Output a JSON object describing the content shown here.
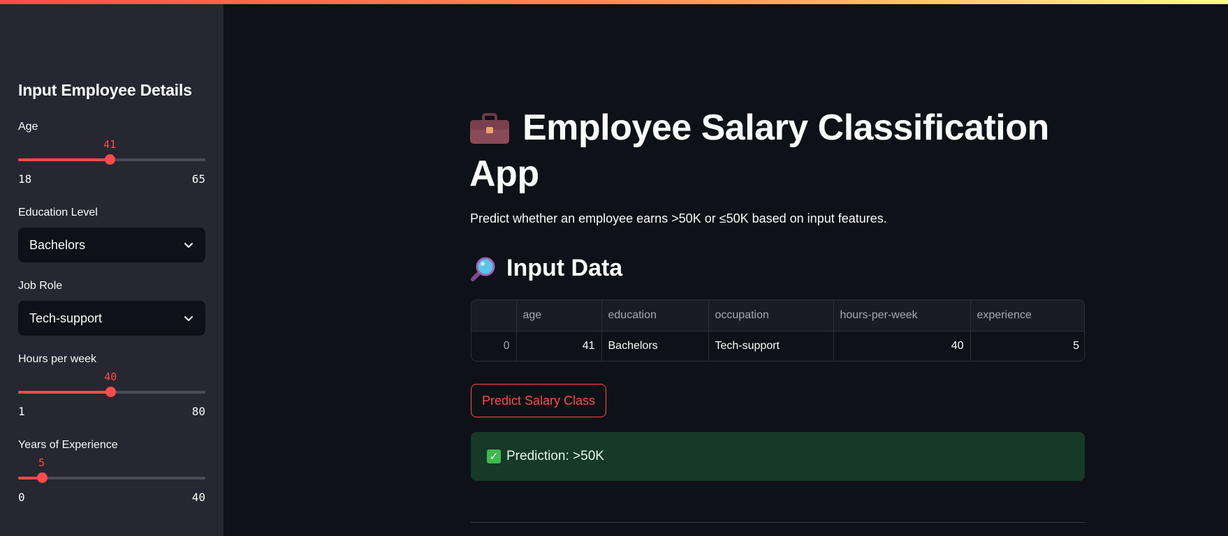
{
  "sidebar": {
    "title": "Input Employee Details",
    "age": {
      "label": "Age",
      "value": 41,
      "min": 18,
      "max": 65
    },
    "education": {
      "label": "Education Level",
      "selected": "Bachelors"
    },
    "job_role": {
      "label": "Job Role",
      "selected": "Tech-support"
    },
    "hours": {
      "label": "Hours per week",
      "value": 40,
      "min": 1,
      "max": 80
    },
    "experience": {
      "label": "Years of Experience",
      "value": 5,
      "min": 0,
      "max": 40
    }
  },
  "main": {
    "title": "Employee Salary Classification App",
    "title_icon": "briefcase-icon",
    "subtitle": "Predict whether an employee earns >50K or ≤50K based on input features.",
    "input_heading": "Input Data",
    "input_icon": "magnifier-icon",
    "table": {
      "columns": [
        "",
        "age",
        "education",
        "occupation",
        "hours-per-week",
        "experience"
      ],
      "rows": [
        [
          "0",
          "41",
          "Bachelors",
          "Tech-support",
          "40",
          "5"
        ]
      ]
    },
    "predict_button": "Predict Salary Class",
    "prediction": "Prediction: >50K",
    "prediction_icon": "check-icon"
  },
  "colors": {
    "accent": "#ff4b4b",
    "background": "#0e1117",
    "sidebar_bg": "#262730",
    "success_bg": "#173928"
  }
}
